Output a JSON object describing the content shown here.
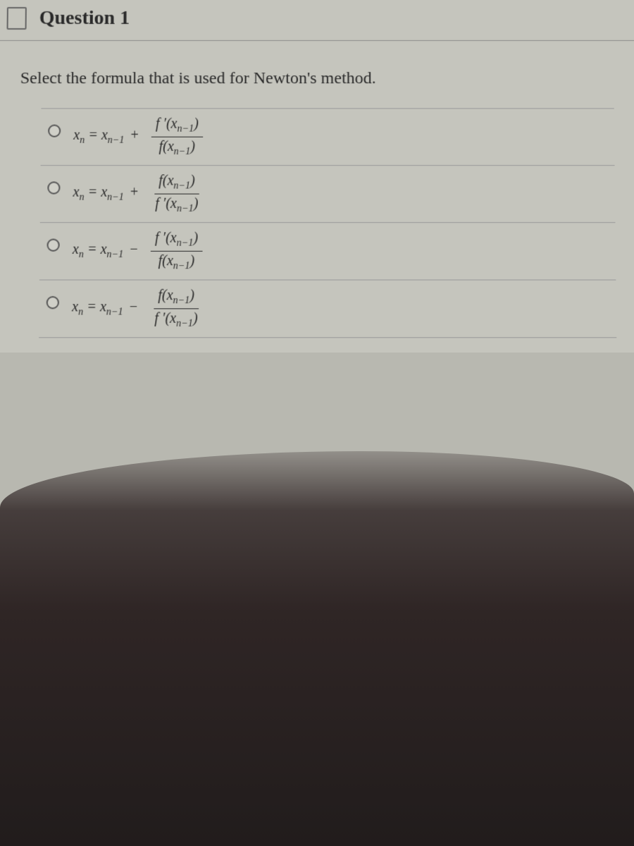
{
  "header": {
    "title": "Question 1"
  },
  "prompt": "Select the formula that is used for Newton's method.",
  "options": [
    {
      "lhs_var": "x",
      "lhs_sub": "n",
      "eq": " = ",
      "rhs_var": "x",
      "rhs_sub": "n−1",
      "op": " + ",
      "num_func": "f ′(",
      "num_arg": "x",
      "num_sub": "n−1",
      "num_close": ")",
      "den_func": "f(",
      "den_arg": "x",
      "den_sub": "n−1",
      "den_close": ")"
    },
    {
      "lhs_var": "x",
      "lhs_sub": "n",
      "eq": " = ",
      "rhs_var": "x",
      "rhs_sub": "n−1",
      "op": " + ",
      "num_func": "f(",
      "num_arg": "x",
      "num_sub": "n−1",
      "num_close": ")",
      "den_func": "f ′(",
      "den_arg": "x",
      "den_sub": "n−1",
      "den_close": ")"
    },
    {
      "lhs_var": "x",
      "lhs_sub": "n",
      "eq": " = ",
      "rhs_var": "x",
      "rhs_sub": "n−1",
      "op": " − ",
      "num_func": "f ′(",
      "num_arg": "x",
      "num_sub": "n−1",
      "num_close": ")",
      "den_func": "f(",
      "den_arg": "x",
      "den_sub": "n−1",
      "den_close": ")"
    },
    {
      "lhs_var": "x",
      "lhs_sub": "n",
      "eq": " = ",
      "rhs_var": "x",
      "rhs_sub": "n−1",
      "op": " − ",
      "num_func": "f(",
      "num_arg": "x",
      "num_sub": "n−1",
      "num_close": ")",
      "den_func": "f ′(",
      "den_arg": "x",
      "den_sub": "n−1",
      "den_close": ")"
    }
  ]
}
